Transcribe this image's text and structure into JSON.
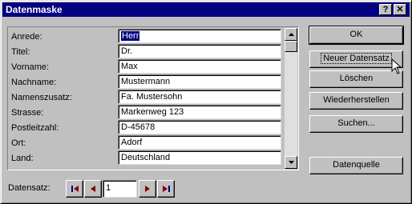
{
  "window": {
    "title": "Datenmaske",
    "help_glyph": "?",
    "close_glyph": "✕"
  },
  "form": {
    "fields": [
      {
        "label": "Anrede:",
        "value": "Herr",
        "selected": true
      },
      {
        "label": "Titel:",
        "value": "Dr."
      },
      {
        "label": "Vorname:",
        "value": "Max"
      },
      {
        "label": "Nachname:",
        "value": "Mustermann"
      },
      {
        "label": "Namenszusatz:",
        "value": "Fa. Mustersohn"
      },
      {
        "label": "Strasse:",
        "value": "Markenweg 123"
      },
      {
        "label": "Postleitzahl:",
        "value": "D-45678"
      },
      {
        "label": "Ort:",
        "value": "Adorf"
      },
      {
        "label": "Land:",
        "value": "Deutschland"
      }
    ]
  },
  "buttons": {
    "ok": "OK",
    "new_record": "Neuer Datensatz",
    "delete": "Löschen",
    "restore": "Wiederherstellen",
    "search": "Suchen...",
    "data_source": "Datenquelle"
  },
  "navigation": {
    "label": "Datensatz:",
    "current_record": "1",
    "first_icon": "first-record-icon",
    "prev_icon": "previous-record-icon",
    "next_icon": "next-record-icon",
    "last_icon": "last-record-icon"
  },
  "colors": {
    "titlebar": "#000080",
    "face": "#c0c0c0",
    "nav_arrow": "#800000"
  }
}
